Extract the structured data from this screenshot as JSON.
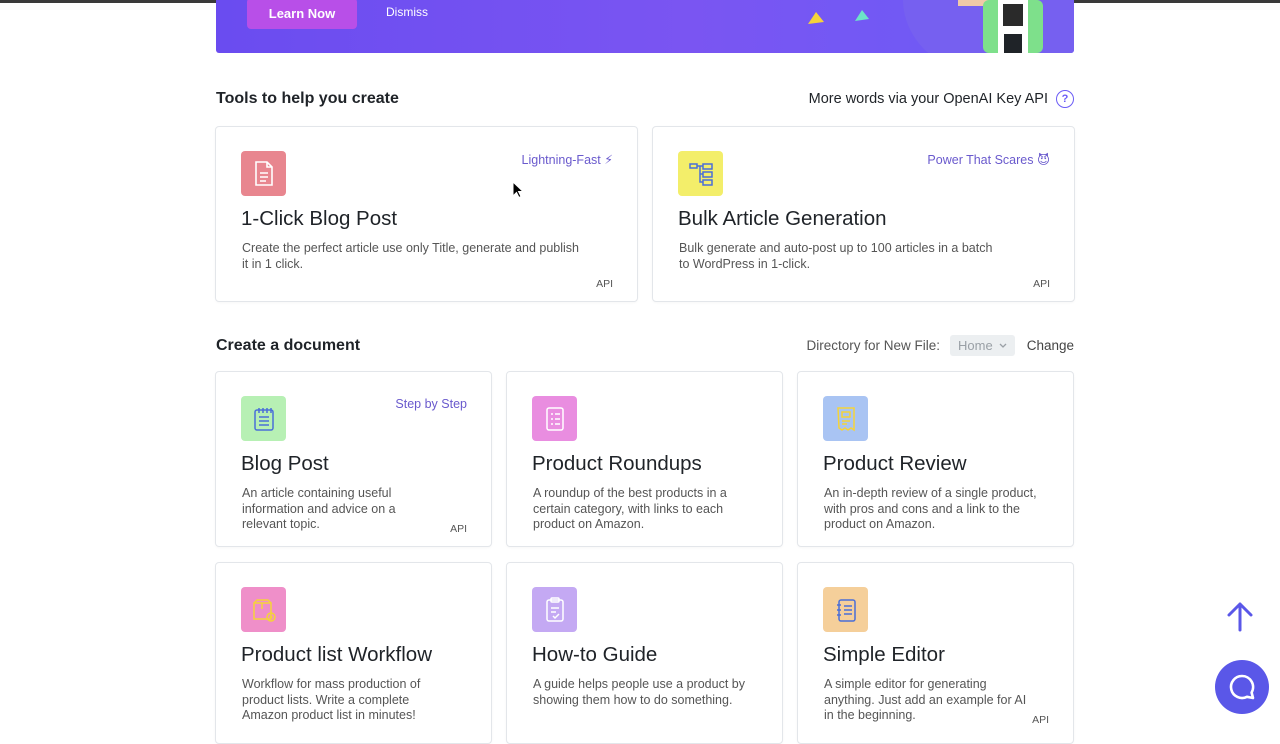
{
  "banner": {
    "learn_label": "Learn Now",
    "dismiss_label": "Dismiss"
  },
  "tools": {
    "title": "Tools to help you create",
    "openai_label": "More words via your OpenAI Key API",
    "cards": [
      {
        "title": "1-Click Blog Post",
        "badge": "Lightning-Fast ⚡",
        "desc": "Create the perfect article use only Title, generate and publish it in 1 click.",
        "api": "API",
        "icon": "document-icon",
        "icon_bg": "#e8868f"
      },
      {
        "title": "Bulk Article Generation",
        "badge": "Power That Scares 😈",
        "desc": "Bulk generate and auto-post up to 100 articles in a batch to WordPress in 1-click.",
        "api": "API",
        "icon": "flowchart-icon",
        "icon_bg": "#f3ee6a"
      }
    ]
  },
  "documents": {
    "title": "Create a document",
    "directory_label": "Directory for New File:",
    "directory_value": "Home",
    "change_label": "Change",
    "cards": [
      {
        "title": "Blog Post",
        "badge": "Step by Step",
        "desc": "An article containing useful information and advice on a relevant topic.",
        "api": "API",
        "icon": "notebook-icon",
        "icon_bg": "#b7f0b4"
      },
      {
        "title": "Product Roundups",
        "badge": "",
        "desc": "A roundup of the best products in a certain category, with links to each product on Amazon.",
        "api": "",
        "icon": "checklist-icon",
        "icon_bg": "#e98de0"
      },
      {
        "title": "Product Review",
        "badge": "",
        "desc": "An in-depth review of a single product, with pros and cons and a link to the product on Amazon.",
        "api": "",
        "icon": "receipt-icon",
        "icon_bg": "#a9c4f3"
      },
      {
        "title": "Product list Workflow",
        "badge": "",
        "desc": "Workflow for mass production of product lists. Write a complete Amazon product list in minutes!",
        "api": "",
        "icon": "package-icon",
        "icon_bg": "#ef8fc9"
      },
      {
        "title": "How-to Guide",
        "badge": "",
        "desc": "A guide helps people use a product by showing them how to do something.",
        "api": "",
        "icon": "guide-icon",
        "icon_bg": "#c4a9f3"
      },
      {
        "title": "Simple Editor",
        "badge": "",
        "desc": "A simple editor for generating anything. Just add an example for AI in the beginning.",
        "api": "API",
        "icon": "editor-icon",
        "icon_bg": "#f5cf9a"
      }
    ]
  },
  "colors": {
    "accent": "#6b5cf6",
    "banner": "#6a4cf0",
    "learn_button": "#b84fe8"
  }
}
